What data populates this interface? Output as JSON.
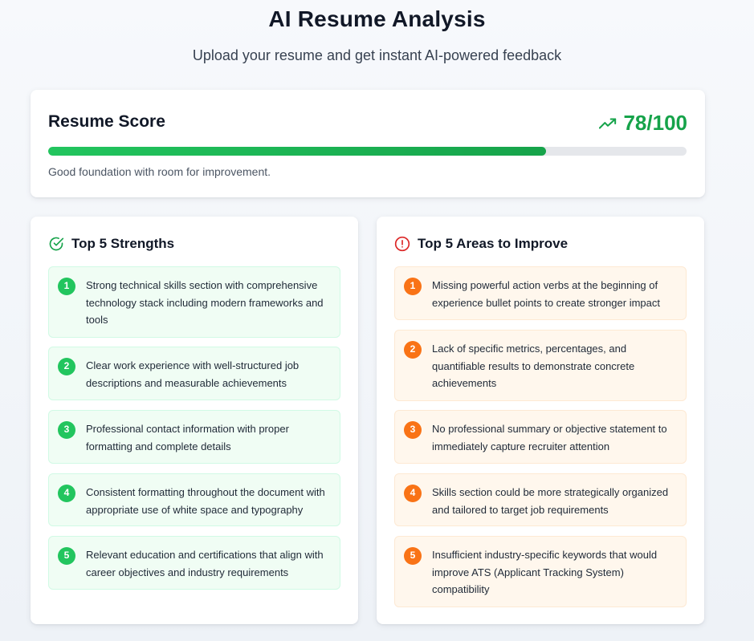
{
  "header": {
    "title": "AI Resume Analysis",
    "subtitle": "Upload your resume and get instant AI-powered feedback"
  },
  "score": {
    "label": "Resume Score",
    "value_text": "78/100",
    "value": 78,
    "max": 100,
    "caption": "Good foundation with room for improvement.",
    "icon": "trending-up-icon",
    "color": "#16a34a"
  },
  "strengths": {
    "title": "Top 5 Strengths",
    "icon": "check-circle-icon",
    "items": [
      {
        "num": "1",
        "text": "Strong technical skills section with comprehensive technology stack including modern frameworks and tools"
      },
      {
        "num": "2",
        "text": "Clear work experience with well-structured job descriptions and measurable achievements"
      },
      {
        "num": "3",
        "text": "Professional contact information with proper formatting and complete details"
      },
      {
        "num": "4",
        "text": "Consistent formatting throughout the document with appropriate use of white space and typography"
      },
      {
        "num": "5",
        "text": "Relevant education and certifications that align with career objectives and industry requirements"
      }
    ]
  },
  "improvements": {
    "title": "Top 5 Areas to Improve",
    "icon": "alert-circle-icon",
    "items": [
      {
        "num": "1",
        "text": "Missing powerful action verbs at the beginning of experience bullet points to create stronger impact"
      },
      {
        "num": "2",
        "text": "Lack of specific metrics, percentages, and quantifiable results to demonstrate concrete achievements"
      },
      {
        "num": "3",
        "text": "No professional summary or objective statement to immediately capture recruiter attention"
      },
      {
        "num": "4",
        "text": "Skills section could be more strategically organized and tailored to target job requirements"
      },
      {
        "num": "5",
        "text": "Insufficient industry-specific keywords that would improve ATS (Applicant Tracking System) compatibility"
      }
    ]
  }
}
